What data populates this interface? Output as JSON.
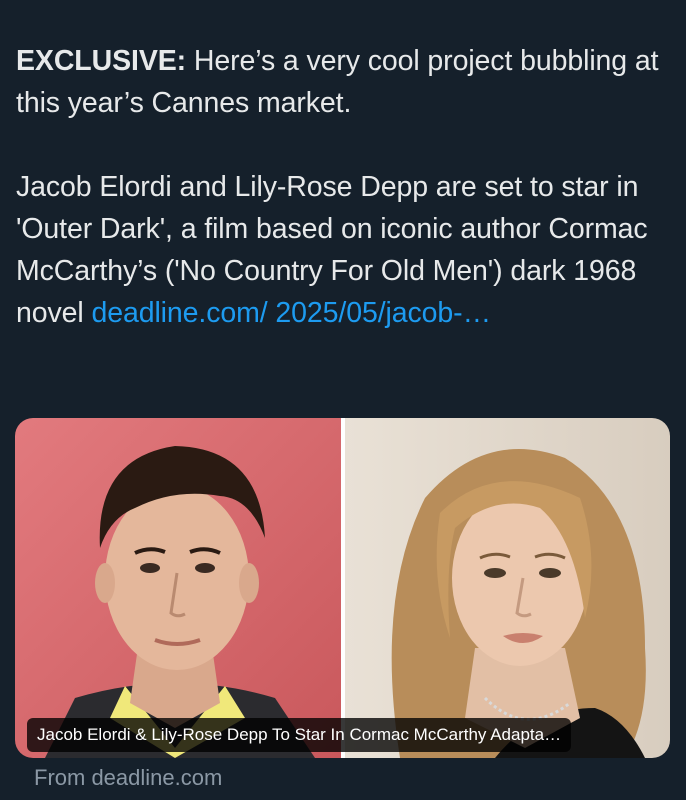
{
  "tweet": {
    "lead_bold": "EXCLUSIVE:",
    "lead_rest": " Here’s a very cool project bubbling at this year’s Cannes market.",
    "para2_text": "Jacob Elordi and Lily-Rose Depp are set to star in 'Outer Dark', a film based on iconic author Cormac McCarthy’s ('No Country For Old Men') dark 1968 novel ",
    "link_text": "deadline.com/ 2025/05/jacob-…"
  },
  "card": {
    "caption": "Jacob Elordi & Lily-Rose Depp To Star In Cormac McCarthy Adapta…",
    "source": "From deadline.com"
  },
  "colors": {
    "background": "#15202b",
    "text": "#e7e9ea",
    "link": "#1d9bf0",
    "muted": "#8b98a5"
  }
}
